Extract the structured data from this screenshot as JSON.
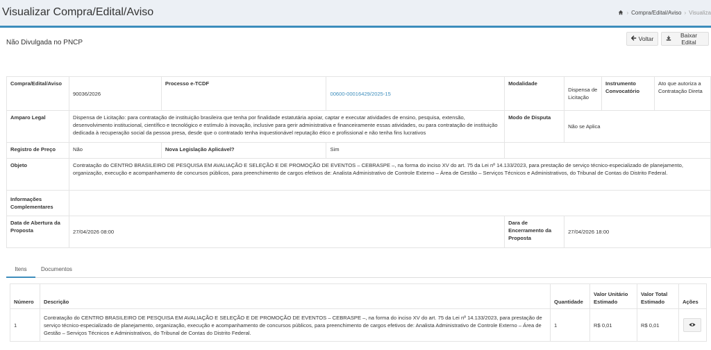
{
  "header": {
    "title": "Visualizar Compra/Edital/Aviso",
    "breadcrumb": [
      "Compra/Edital/Aviso",
      "Visualiza"
    ]
  },
  "box": {
    "title": "Não Divulgada no PNCP",
    "buttons": {
      "voltar": "Voltar",
      "baixar": "Baixar Edital"
    }
  },
  "info": {
    "compra_label": "Compra/Edital/Aviso",
    "compra_value": "90036/2026",
    "processo_label": "Processo e-TCDF",
    "processo_value": "00600-00016429/2025-15",
    "modalidade_label": "Modalidade",
    "modalidade_value": "Dispensa de Licitação",
    "instrumento_label": "Instrumento Convocatório",
    "instrumento_value": "Ato que autoriza a Contratação Direta",
    "amparo_label": "Amparo Legal",
    "amparo_value": "Dispensa de Licitação: para contratação de instituição brasileira que tenha por finalidade estatutária apoiar, captar e executar atividades de ensino, pesquisa, extensão, desenvolvimento institucional, científico e tecnológico e estímulo à inovação, inclusive para gerir administrativa e financeiramente essas atividades, ou para contratação de instituição dedicada à recuperação social da pessoa presa, desde que o contratado tenha inquestionável reputação ético e profissional e não tenha fins lucrativos",
    "modo_label": "Modo de Disputa",
    "modo_value": "Não se Aplica",
    "registro_label": "Registro de Preço",
    "registro_value": "Não",
    "nova_label": "Nova Legislação Aplicável?",
    "nova_value": "Sim",
    "objeto_label": "Objeto",
    "objeto_value": "Contratação do CENTRO BRASILEIRO DE PESQUISA EM AVALIAÇÃO E SELEÇÃO E DE PROMOÇÃO DE EVENTOS – CEBRASPE –, na forma do inciso XV do art. 75 da Lei nº 14.133/2023, para prestação de serviço técnico-especializado de planejamento, organização, execução e acompanhamento de concursos públicos, para preenchimento de cargos efetivos de: Analista Administrativo de Controle Externo – Área de Gestão – Serviços Técnicos e Administrativos, do Tribunal de Contas do Distrito Federal.",
    "info_label": "Informações Complementares",
    "info_value": "",
    "abertura_label": "Data de Abertura da Proposta",
    "abertura_value": "27/04/2026 08:00",
    "encerramento_label": "Dara de Encerramento da Proposta",
    "encerramento_value": "27/04/2026 18:00"
  },
  "tabs": [
    "Itens",
    "Documentos"
  ],
  "items": {
    "headers": {
      "numero": "Número",
      "descricao": "Descrição",
      "quantidade": "Quantidade",
      "unitario": "Valor Unitário Estimado",
      "total": "Valor Total Estimado",
      "acoes": "Ações"
    },
    "rows": [
      {
        "numero": "1",
        "descricao": "Contratação do CENTRO BRASILEIRO DE PESQUISA EM AVALIAÇÃO E SELEÇÃO E DE PROMOÇÃO DE EVENTOS – CEBRASPE –, na forma do inciso XV do art. 75 da Lei nº 14.133/2023, para prestação de serviço técnico-especializado de planejamento, organização, execução e acompanhamento de concursos públicos, para preenchimento de cargos efetivos de: Analista Administrativo de Controle Externo – Área de Gestão – Serviços Técnicos e Administrativos, do Tribunal de Contas do Distrito Federal.",
        "quantidade": "1",
        "unitario": "R$ 0,01",
        "total": "R$ 0,01"
      }
    ]
  },
  "colors": {
    "accent": "#3c8dbc",
    "background": "#ecf0f5"
  }
}
